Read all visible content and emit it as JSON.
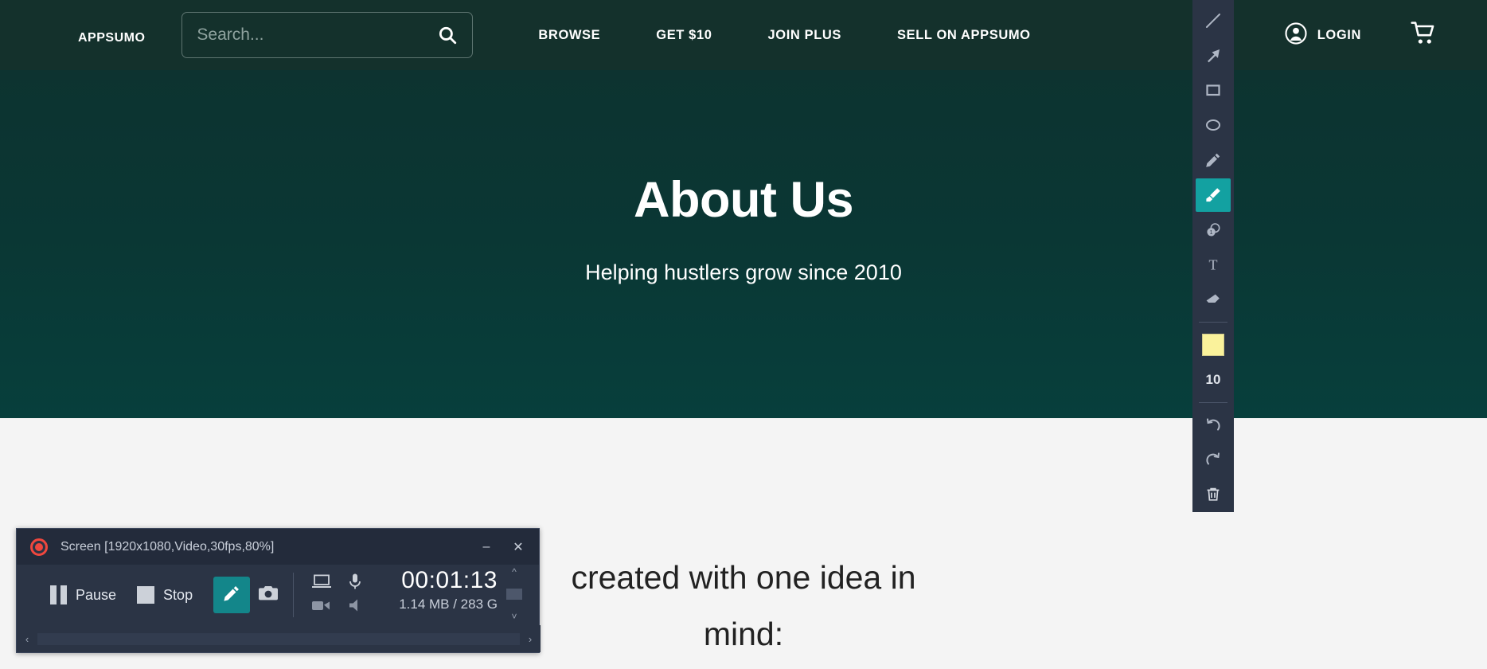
{
  "header": {
    "logo": "AppSumo",
    "search": {
      "placeholder": "Search...",
      "value": "",
      "icon": "search-icon"
    },
    "nav": [
      {
        "label": "BROWSE"
      },
      {
        "label": "GET $10"
      },
      {
        "label": "JOIN PLUS"
      },
      {
        "label": "SELL ON APPSUMO"
      }
    ],
    "login": {
      "label": "LOGIN",
      "icon": "user-circle-icon"
    },
    "cart": {
      "icon": "shopping-cart-icon"
    },
    "background": "#14312c"
  },
  "hero": {
    "title": "About Us",
    "subtitle": "Helping hustlers grow since 2010",
    "background": "#0a3734"
  },
  "body": {
    "line1": "created with one idea in",
    "line2": "mind:"
  },
  "annotation_toolbar": {
    "background": "#2b3445",
    "active_color": "#13a1a1",
    "tools": [
      {
        "name": "line-tool",
        "icon": "line-icon",
        "active": false
      },
      {
        "name": "arrow-tool",
        "icon": "arrow-icon",
        "active": false
      },
      {
        "name": "rectangle-tool",
        "icon": "rectangle-icon",
        "active": false
      },
      {
        "name": "ellipse-tool",
        "icon": "ellipse-icon",
        "active": false
      },
      {
        "name": "pencil-tool",
        "icon": "pencil-icon",
        "active": false
      },
      {
        "name": "highlighter-tool",
        "icon": "highlighter-icon",
        "active": true
      },
      {
        "name": "step-number-tool",
        "icon": "numbered-step-icon",
        "active": false
      },
      {
        "name": "text-tool",
        "icon": "text-t-icon",
        "active": false
      },
      {
        "name": "eraser-tool",
        "icon": "eraser-icon",
        "active": false
      }
    ],
    "color_swatch": "#faf29b",
    "stroke_size": "10",
    "actions": [
      {
        "name": "undo-button",
        "icon": "undo-icon"
      },
      {
        "name": "redo-button",
        "icon": "redo-icon"
      },
      {
        "name": "delete-button",
        "icon": "trash-icon"
      }
    ]
  },
  "recorder": {
    "title": "Screen [1920x1080,Video,30fps,80%]",
    "record_indicator": "record-dot-icon",
    "window_buttons": {
      "minimize": "–",
      "close": "✕"
    },
    "pause_label": "Pause",
    "stop_label": "Stop",
    "draw_button": {
      "icon": "pencil-icon",
      "active": true
    },
    "screenshot_button": {
      "icon": "camera-icon"
    },
    "devices": [
      {
        "name": "screen-device-toggle",
        "icon": "laptop-icon"
      },
      {
        "name": "microphone-device-toggle",
        "icon": "microphone-icon"
      },
      {
        "name": "webcam-device-toggle",
        "icon": "webcam-icon"
      },
      {
        "name": "speaker-device-toggle",
        "icon": "speaker-icon"
      }
    ],
    "timer": "00:01:13",
    "filesize": "1.14 MB / 283 G",
    "accent": "#13868a"
  }
}
